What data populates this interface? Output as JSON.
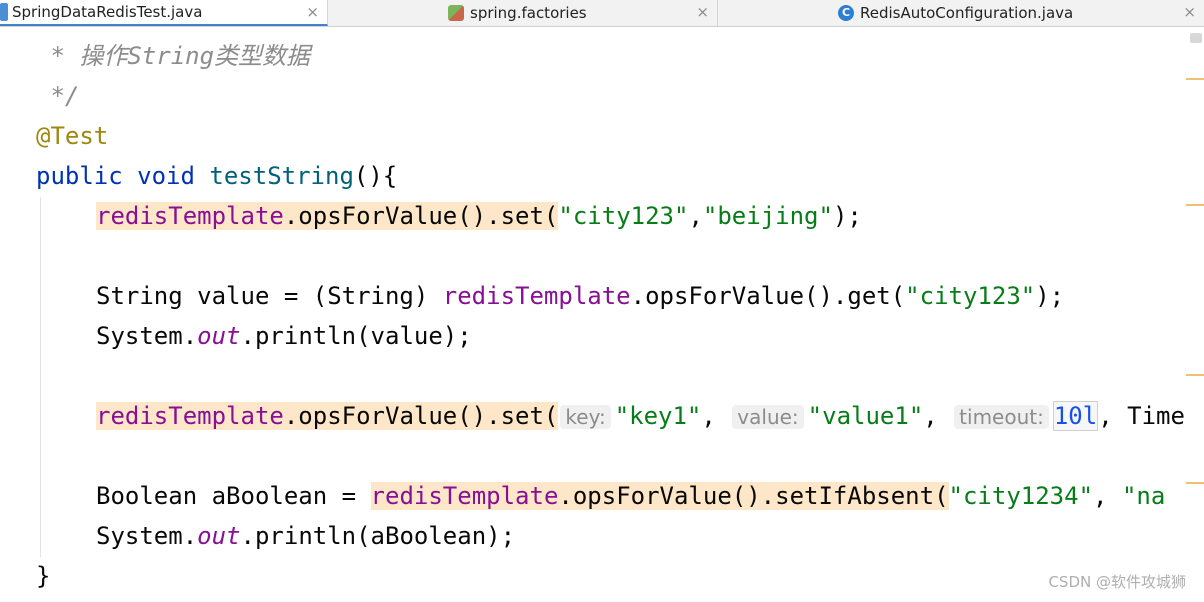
{
  "tabs": [
    {
      "label": "SpringDataRedisTest.java",
      "icon": "java-file-icon",
      "close": "×",
      "active": true
    },
    {
      "label": "spring.factories",
      "icon": "factories-file-icon",
      "close": "×",
      "active": false
    },
    {
      "label": "RedisAutoConfiguration.java",
      "icon": "class-icon",
      "close": "×",
      "active": false
    }
  ],
  "code": {
    "comment1": " * 操作String类型数据",
    "comment2": " */",
    "annotation": "@Test",
    "kw_public": "public",
    "kw_void": "void",
    "method_name": "testString",
    "sig_rest": "(){",
    "l5": {
      "field": "redisTemplate",
      "call": ".opsForValue().set(",
      "s1": "\"city123\"",
      "comma": ",",
      "s2": "\"beijing\"",
      "end": ");"
    },
    "l7": {
      "pre": "String value = (String) ",
      "field": "redisTemplate",
      "call": ".opsForValue().get(",
      "s1": "\"city123\"",
      "end": ");"
    },
    "l8": {
      "pre": "System.",
      "out": "out",
      "rest": ".println(value);"
    },
    "l10": {
      "field": "redisTemplate",
      "call": ".opsForValue().set(",
      "hint_key": "key:",
      "s1": "\"key1\"",
      "c1": ", ",
      "hint_value": "value:",
      "s2": "\"value1\"",
      "c2": ", ",
      "hint_timeout": "timeout:",
      "num": "10l",
      "rest": ", Time"
    },
    "l12": {
      "pre": "Boolean aBoolean = ",
      "field": "redisTemplate",
      "call": ".opsForValue().setIfAbsent(",
      "s1": "\"city1234\"",
      "c1": ", ",
      "s2": "\"na"
    },
    "l13": {
      "pre": "System.",
      "out": "out",
      "rest": ".println(aBoolean);"
    },
    "close_brace": "}"
  },
  "watermark": "CSDN @软件攻城狮"
}
